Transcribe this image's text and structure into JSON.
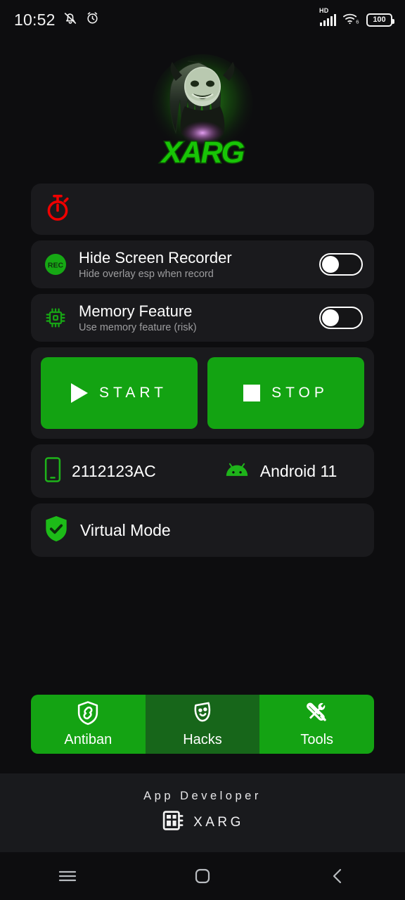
{
  "status_bar": {
    "time": "10:52",
    "icons_left": [
      "mute-bell-icon",
      "alarm-icon"
    ],
    "network_label": "HD",
    "wifi": "wifi-6-icon",
    "battery_percent": "100"
  },
  "logo": {
    "brand_text": "XARG",
    "description": "green-glowing creature mascot logo",
    "glow_color": "#32e015"
  },
  "timer_card": {
    "icon": "stopwatch-icon",
    "icon_color": "#ef0000",
    "value": ""
  },
  "settings": [
    {
      "icon": "rec-icon",
      "icon_text": "REC",
      "title": "Hide Screen Recorder",
      "subtitle": "Hide overlay esp when record",
      "toggle_state": "off"
    },
    {
      "icon": "memory-chip-icon",
      "title": "Memory Feature",
      "subtitle": "Use memory feature (risk)",
      "toggle_state": "off"
    }
  ],
  "actions": {
    "start_label": "START",
    "stop_label": "STOP",
    "button_color": "#13a312"
  },
  "device": {
    "model_icon": "phone-icon",
    "model": "2112123AC",
    "os_icon": "android-icon",
    "os": "Android 11",
    "mode_icon": "shield-check-icon",
    "mode": "Virtual Mode"
  },
  "tabs": [
    {
      "label": "Antiban",
      "icon": "shield-link-icon",
      "active": true
    },
    {
      "label": "Hacks",
      "icon": "theater-mask-icon",
      "active": false
    },
    {
      "label": "Tools",
      "icon": "tools-icon",
      "active": true
    }
  ],
  "footer": {
    "title": "App Developer",
    "developer_icon": "chip-dashboard-icon",
    "developer": "XARG"
  },
  "navbar": {
    "recents": "menu-icon",
    "home": "home-square-icon",
    "back": "back-chevron-icon"
  }
}
